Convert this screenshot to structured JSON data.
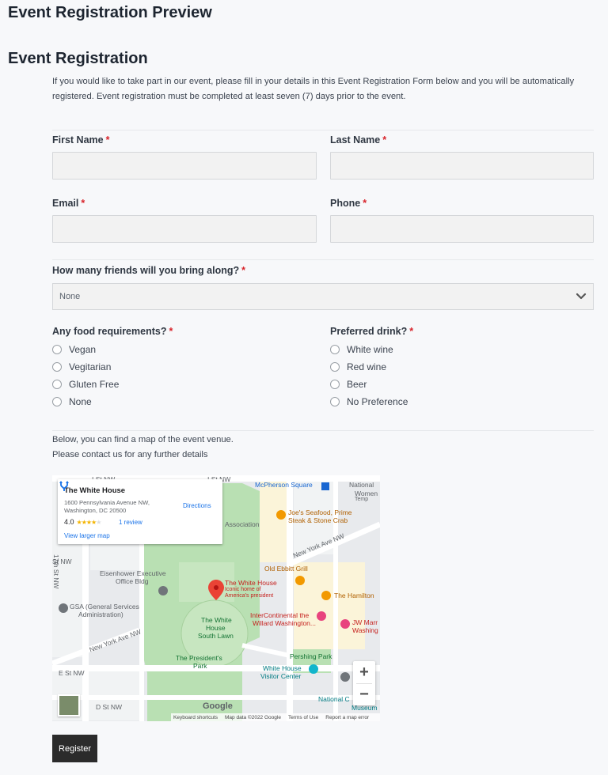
{
  "page": {
    "preview_title": "Event Registration Preview",
    "form_title": "Event Registration",
    "intro_text": "If you would like to take part in our event, please fill in your details in this Event Registration Form below and you will be automatically registered. Event registration must be completed at least seven (7) days prior to the event."
  },
  "form": {
    "required_mark": "*",
    "first_name": {
      "label": "First Name",
      "value": ""
    },
    "last_name": {
      "label": "Last Name",
      "value": ""
    },
    "email": {
      "label": "Email",
      "value": ""
    },
    "phone": {
      "label": "Phone",
      "value": ""
    },
    "friends": {
      "label": "How many friends will you bring along?",
      "selected": "None"
    },
    "food": {
      "label": "Any food requirements?",
      "options": [
        "Vegan",
        "Vegitarian",
        "Gluten Free",
        "None"
      ]
    },
    "drink": {
      "label": "Preferred drink?",
      "options": [
        "White wine",
        "Red wine",
        "Beer",
        "No Preference"
      ]
    },
    "map_note_1": "Below, you can find a map of the event venue.",
    "map_note_2": "Please contact us for any further details",
    "register_label": "Register"
  },
  "map": {
    "card": {
      "title": "The White House",
      "address": "1600 Pennsylvania Avenue NW, Washington, DC 20500",
      "rating": "4.0",
      "reviews": "1 review",
      "larger_map": "View larger map",
      "directions": "Directions"
    },
    "labels": {
      "l_st_1": "I St NW",
      "l_st_2": "I St NW",
      "mcpherson": "McPherson Square",
      "national": "National",
      "women": "Women",
      "temp": "Temp",
      "association": "Association",
      "joes_1": "Joe's Seafood, Prime",
      "joes_2": "Steak & Stone Crab",
      "ny_ave_1": "New York Ave NW",
      "ny_ave_2": "New York Ave NW",
      "eisenhower_1": "Eisenhower Executive",
      "eisenhower_2": "Office Bldg",
      "ebbitt": "Old Ebbitt Grill",
      "wh_1": "The White House",
      "wh_2": "Iconic home of",
      "wh_3": "America's president",
      "hamilton": "The Hamilton",
      "gsa_1": "GSA (General Services",
      "gsa_2": "Administration)",
      "intercon_1": "InterContinental the",
      "intercon_2": "Willard Washington...",
      "jw_1": "JW Marr",
      "jw_2": "Washing",
      "lawn_1": "The White",
      "lawn_2": "House",
      "lawn_3": "South Lawn",
      "pershing": "Pershing Park",
      "park_1": "The President's",
      "park_2": "Park",
      "visitor_1": "White House",
      "visitor_2": "Visitor Center",
      "e_st": "E St NW",
      "d_st": "D St NW",
      "nat_c_1": "National C",
      "nat_c_2": "Museum",
      "st_nw": "St NW",
      "th_st_nw": "17th St NW"
    },
    "attribution": [
      "Keyboard shortcuts",
      "Map data ©2022 Google",
      "Terms of Use",
      "Report a map error"
    ],
    "google": "Google",
    "zoom_in": "+",
    "zoom_out": "−"
  }
}
